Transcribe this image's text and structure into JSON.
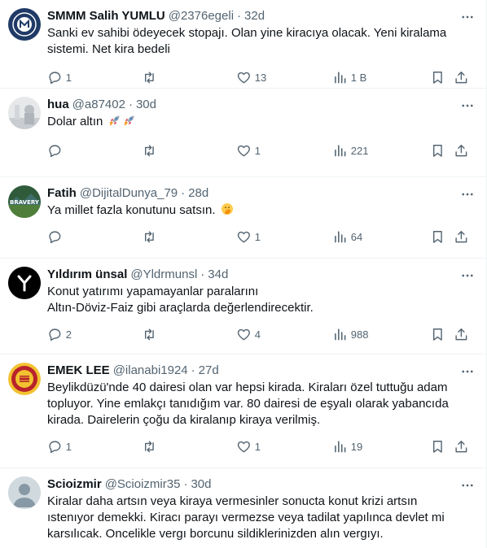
{
  "tweets": [
    {
      "name": "SMMM Salih YUMLU",
      "handle": "@2376egeli",
      "dot": "·",
      "time": "32d",
      "text": "Sanki ev sahibi ödeyecek stopajı. Olan yine kiracıya olacak. Yeni kiralama\nsistemi. Net kira bedeli",
      "replies": "1",
      "retweets": "",
      "likes": "13",
      "views": "1 B"
    },
    {
      "name": "hua",
      "handle": "@a87402",
      "dot": "·",
      "time": "30d",
      "text": "Dolar altın",
      "emoji": [
        "rocket",
        "rocket"
      ],
      "replies": "",
      "retweets": "",
      "likes": "1",
      "views": "221"
    },
    {
      "name": "Fatih",
      "handle": "@DijitalDunya_79",
      "dot": "·",
      "time": "28d",
      "text": "Ya millet fazla konutunu satsın.",
      "emoji": [
        "hand-over-mouth-face"
      ],
      "replies": "",
      "retweets": "",
      "likes": "1",
      "views": "64"
    },
    {
      "name": "Yıldırım ünsal",
      "handle": "@Yldrmunsl",
      "dot": "·",
      "time": "34d",
      "text": "Konut yatırımı yapamayanlar paralarını\nAltın-Döviz-Faiz gibi araçlarda değerlendirecektir.",
      "replies": "2",
      "retweets": "",
      "likes": "4",
      "views": "988"
    },
    {
      "name": "EMEK LEE",
      "handle": "@ilanabi1924",
      "dot": "·",
      "time": "27d",
      "text": "Beylikdüzü'nde 40 dairesi olan var hepsi kirada. Kiraları özel tuttuğu adam\ntopluyor. Yine emlakçı tanıdığım var. 80 dairesi de eşyalı olarak yabancıda\nkirada. Dairelerin çoğu da kiralanıp kiraya verilmiş.",
      "replies": "1",
      "retweets": "",
      "likes": "1",
      "views": "19"
    },
    {
      "name": "Scioizmir",
      "handle": "@Scioizmir35",
      "dot": "·",
      "time": "30d",
      "text": "Kiralar daha artsın  veya kiraya vermesinler sonucta konut krizi artsın\nıstenıyor demekki. Kiracı parayı vermezse veya tadilat yapılınca devlet mi\nkarsılıcak. Oncelikle vergı borcunu sildiklerinizden alın vergıyı.",
      "replies": "",
      "retweets": "",
      "likes": "",
      "views": ""
    }
  ],
  "colors": {
    "text": "#0f1419",
    "secondary": "#536471",
    "border": "#eff3f4"
  }
}
